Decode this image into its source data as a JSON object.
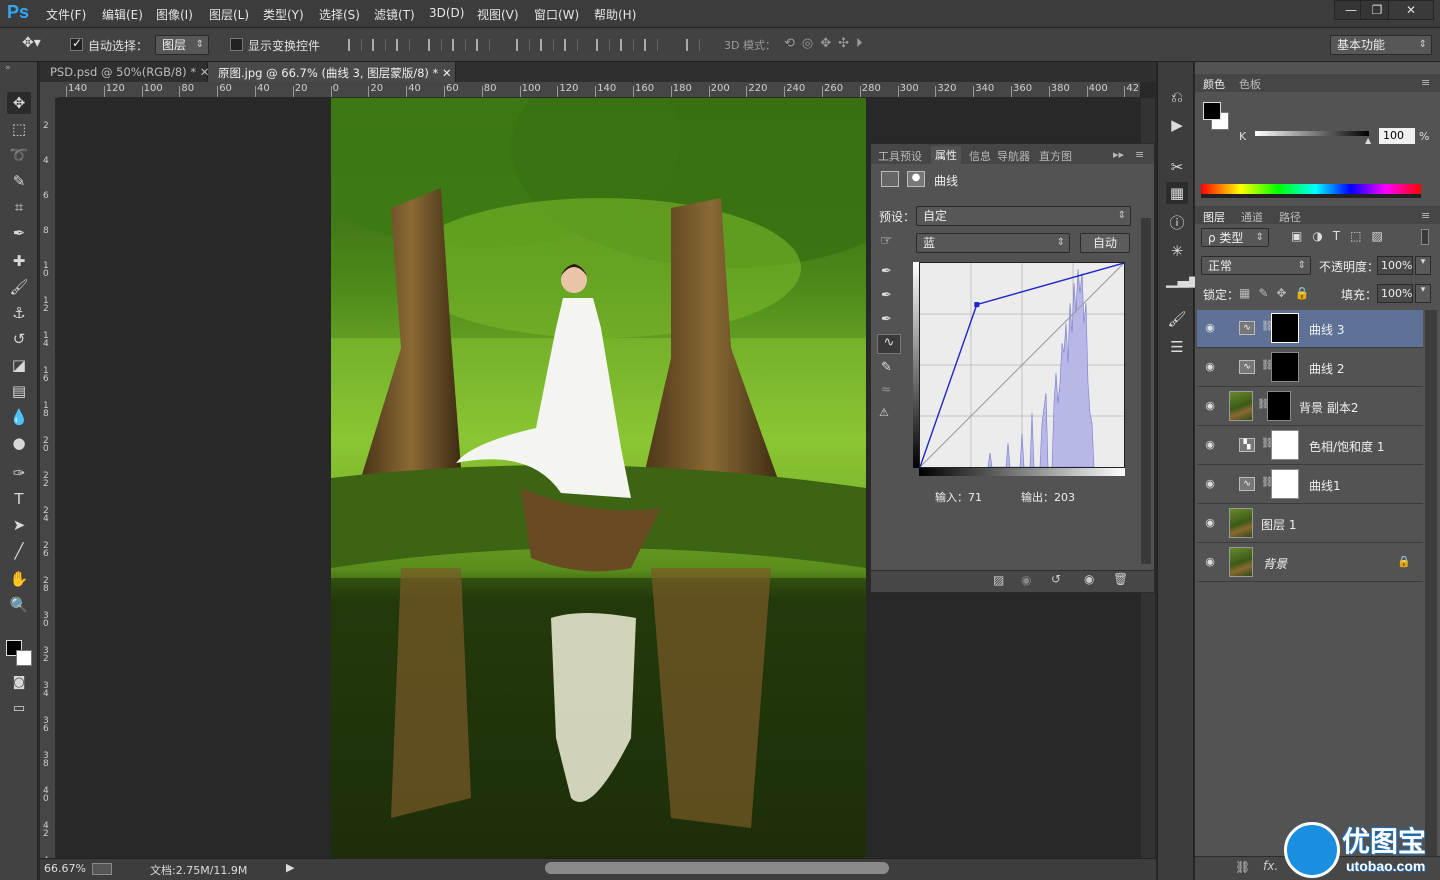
{
  "app": {
    "logo": "Ps",
    "menu": [
      "文件(F)",
      "编辑(E)",
      "图像(I)",
      "图层(L)",
      "类型(Y)",
      "选择(S)",
      "滤镜(T)",
      "3D(D)",
      "视图(V)",
      "窗口(W)",
      "帮助(H)"
    ],
    "window_buttons": [
      "—",
      "❐",
      "✕"
    ]
  },
  "options": {
    "auto_select_label": "自动选择：",
    "auto_select_checked": true,
    "auto_select_target": "图层",
    "show_transform_label": "显示变换控件",
    "mode_3d_label": "3D 模式：",
    "workspace": "基本功能"
  },
  "tabs": [
    {
      "label": "PSD.psd @ 50%(RGB/8) *",
      "active": false
    },
    {
      "label": "原图.jpg @ 66.7% (曲线 3, 图层蒙版/8) *",
      "active": true
    }
  ],
  "rulers": {
    "h": [
      "140",
      "120",
      "100",
      "80",
      "60",
      "40",
      "20",
      "0",
      "20",
      "40",
      "60",
      "80",
      "100",
      "120",
      "140",
      "160",
      "180",
      "200",
      "220",
      "240",
      "260",
      "280",
      "300",
      "320",
      "340",
      "360",
      "380",
      "400",
      "42"
    ],
    "v": [
      "2",
      "4",
      "6",
      "8",
      "10",
      "12",
      "14",
      "16",
      "18",
      "20",
      "22",
      "24",
      "26",
      "28",
      "30",
      "32",
      "34",
      "36",
      "38",
      "40",
      "42",
      "44"
    ]
  },
  "status": {
    "zoom": "66.67%",
    "doc": "文档:2.75M/11.9M"
  },
  "properties": {
    "tabs": [
      "工具预设",
      "属性",
      "信息",
      "导航器",
      "直方图"
    ],
    "active_tab": "属性",
    "title": "曲线",
    "preset_label": "预设：",
    "preset_value": "自定",
    "channel": "蓝",
    "auto_button": "自动",
    "input_label": "输入：71",
    "output_label": "输出：203",
    "curve_point": {
      "input": 71,
      "output": 203
    }
  },
  "color_panel": {
    "tabs": [
      "颜色",
      "色板"
    ],
    "channel_label": "K",
    "value": "100",
    "unit": "%"
  },
  "layers_panel": {
    "tabs": [
      "图层",
      "通道",
      "路径"
    ],
    "filter": "ρ 类型",
    "blend_mode": "正常",
    "opacity_label": "不透明度：",
    "opacity": "100%",
    "lock_label": "锁定：",
    "fill_label": "填充：",
    "fill": "100%",
    "layers": [
      {
        "name": "曲线 3",
        "type": "curves",
        "selected": true
      },
      {
        "name": "曲线 2",
        "type": "curves",
        "selected": false
      },
      {
        "name": "背景 副本2",
        "type": "pixel-mask",
        "selected": false
      },
      {
        "name": "色相/饱和度 1",
        "type": "hue",
        "selected": false
      },
      {
        "name": "曲线1",
        "type": "curves",
        "selected": false
      },
      {
        "name": "图层 1",
        "type": "pixel",
        "selected": false
      },
      {
        "name": "背景",
        "type": "background",
        "selected": false
      }
    ]
  },
  "watermark": {
    "brand": "优图宝",
    "url": "utobao.com"
  }
}
